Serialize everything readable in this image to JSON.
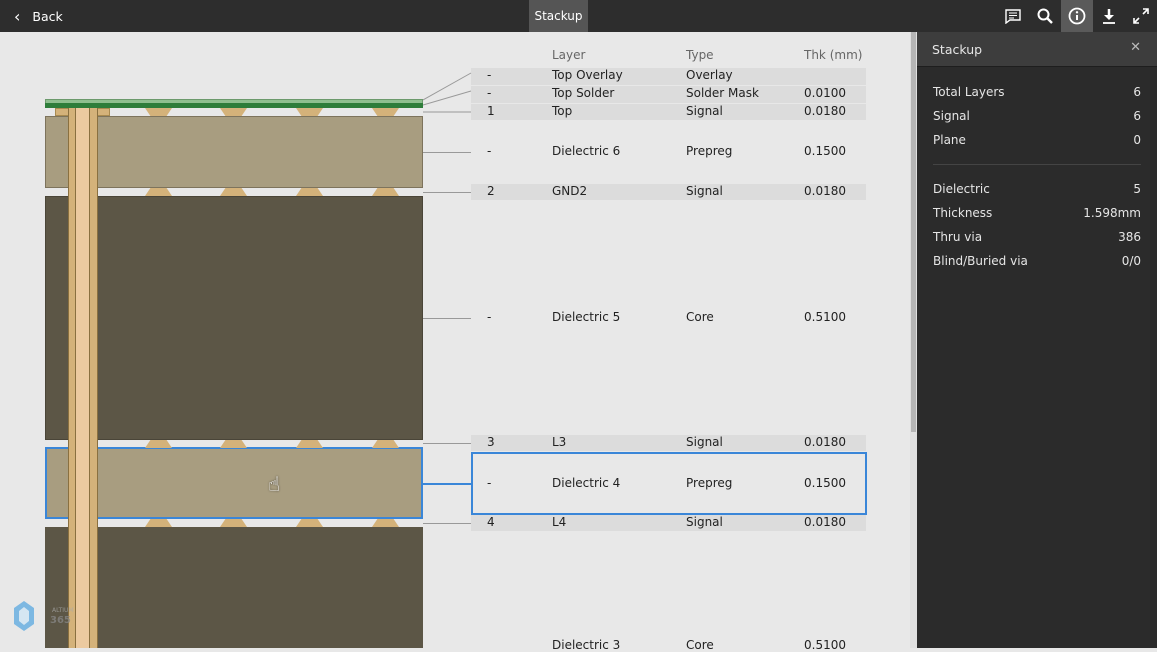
{
  "topbar": {
    "back_label": "Back",
    "title": "Stackup",
    "icons": [
      "comment-icon",
      "search-icon",
      "info-icon",
      "download-icon",
      "fullscreen-icon"
    ]
  },
  "panel": {
    "title": "Stackup",
    "stats": [
      {
        "label": "Total Layers",
        "value": "6"
      },
      {
        "label": "Signal",
        "value": "6"
      },
      {
        "label": "Plane",
        "value": "0"
      },
      {
        "label": "Dielectric",
        "value": "5"
      },
      {
        "label": "Thickness",
        "value": "1.598mm"
      },
      {
        "label": "Thru via",
        "value": "386"
      },
      {
        "label": "Blind/Buried via",
        "value": "0/0"
      }
    ]
  },
  "table": {
    "headers": [
      "Layer",
      "Type",
      "Thk (mm)"
    ],
    "rows": [
      {
        "num": "-",
        "layer": "Top Overlay",
        "type": "Overlay",
        "thk": ""
      },
      {
        "num": "-",
        "layer": "Top Solder",
        "type": "Solder Mask",
        "thk": "0.0100"
      },
      {
        "num": "1",
        "layer": "Top",
        "type": "Signal",
        "thk": "0.0180"
      },
      {
        "num": "-",
        "layer": "Dielectric 6",
        "type": "Prepreg",
        "thk": "0.1500"
      },
      {
        "num": "2",
        "layer": "GND2",
        "type": "Signal",
        "thk": "0.0180"
      },
      {
        "num": "-",
        "layer": "Dielectric 5",
        "type": "Core",
        "thk": "0.5100"
      },
      {
        "num": "3",
        "layer": "L3",
        "type": "Signal",
        "thk": "0.0180"
      },
      {
        "num": "-",
        "layer": "Dielectric 4",
        "type": "Prepreg",
        "thk": "0.1500"
      },
      {
        "num": "4",
        "layer": "L4",
        "type": "Signal",
        "thk": "0.0180"
      },
      {
        "num": "",
        "layer": "Dielectric 3",
        "type": "Core",
        "thk": "0.5100"
      }
    ]
  },
  "colors": {
    "accent": "#3a86d8",
    "prepreg": "#a89d80",
    "core": "#5c5646",
    "copper": "#d4b27a",
    "solder": "#2e7d3a",
    "overlay": "#8fbf8f"
  },
  "logo": {
    "text": "ALTIUM 365"
  }
}
